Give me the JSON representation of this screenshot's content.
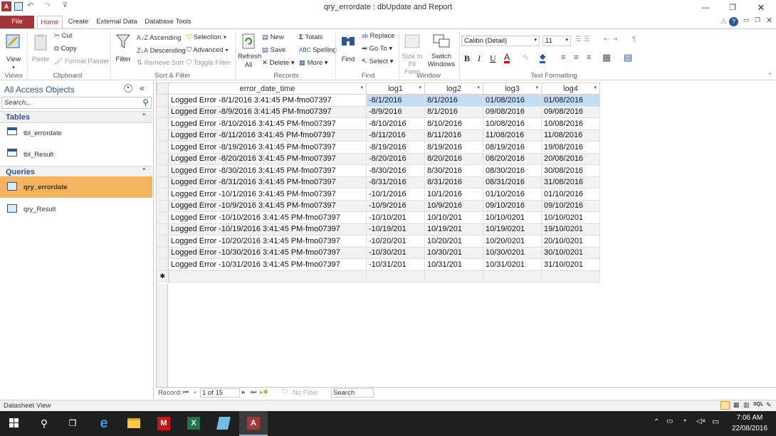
{
  "window": {
    "title": "qry_errordate : dbUpdate and Report"
  },
  "ribbon_tabs": [
    "File",
    "Home",
    "Create",
    "External Data",
    "Database Tools"
  ],
  "ribbon": {
    "views": {
      "view": "View",
      "group": "Views"
    },
    "clipboard": {
      "paste": "Paste",
      "cut": "Cut",
      "copy": "Copy",
      "format_painter": "Format Painter",
      "group": "Clipboard"
    },
    "sort_filter": {
      "filter": "Filter",
      "ascending": "Ascending",
      "descending": "Descending",
      "remove_sort": "Remove Sort",
      "selection": "Selection",
      "advanced": "Advanced",
      "toggle_filter": "Toggle Filter",
      "group": "Sort & Filter"
    },
    "records": {
      "refresh_all": "Refresh All",
      "new": "New",
      "save": "Save",
      "delete": "Delete",
      "totals": "Totals",
      "spelling": "Spelling",
      "more": "More",
      "group": "Records"
    },
    "find": {
      "find": "Find",
      "replace": "Replace",
      "go_to": "Go To",
      "select": "Select",
      "group": "Find"
    },
    "window": {
      "size_to_fit": "Size to Fit Form",
      "switch_windows": "Switch Windows",
      "group": "Window"
    },
    "text_formatting": {
      "font": "Calibri (Detail)",
      "size": "11",
      "group": "Text Formatting",
      "bold": "B",
      "italic": "I",
      "underline": "U",
      "font_color": "A"
    }
  },
  "nav": {
    "title": "All Access Objects",
    "search_placeholder": "Search...",
    "tables_header": "Tables",
    "tables": [
      "tbl_errordate",
      "tbl_Result"
    ],
    "queries_header": "Queries",
    "queries": [
      "qry_errordate",
      "qry_Result"
    ]
  },
  "datasheet": {
    "columns": [
      "error_date_time",
      "log1",
      "log2",
      "log3",
      "log4"
    ],
    "rows": [
      [
        "Logged Error -8/1/2016 3:41:45 PM-fmo07397",
        "-8/1/2016",
        "8/1/2016",
        "01/08/2016",
        "01/08/2016"
      ],
      [
        "Logged Error -8/9/2016 3:41:45 PM-fmo07397",
        "-8/9/2016",
        "8/1/2016",
        "09/08/2016",
        "09/08/2016"
      ],
      [
        "Logged Error -8/10/2016 3:41:45 PM-fmo07397",
        "-8/10/2016",
        "8/10/2016",
        "10/08/2016",
        "10/08/2016"
      ],
      [
        "Logged Error -8/11/2016 3:41:45 PM-fmo07397",
        "-8/11/2016",
        "8/11/2016",
        "11/08/2016",
        "11/08/2016"
      ],
      [
        "Logged Error -8/19/2016 3:41:45 PM-fmo07397",
        "-8/19/2016",
        "8/19/2016",
        "08/19/2016",
        "19/08/2016"
      ],
      [
        "Logged Error -8/20/2016 3:41:45 PM-fmo07397",
        "-8/20/2016",
        "8/20/2016",
        "08/20/2016",
        "20/08/2016"
      ],
      [
        "Logged Error -8/30/2016 3:41:45 PM-fmo07397",
        "-8/30/2016",
        "8/30/2016",
        "08/30/2016",
        "30/08/2016"
      ],
      [
        "Logged Error -8/31/2016 3:41:45 PM-fmo07397",
        "-8/31/2016",
        "8/31/2016",
        "08/31/2016",
        "31/08/2016"
      ],
      [
        "Logged Error -10/1/2016 3:41:45 PM-fmo07397",
        "-10/1/2016",
        "10/1/2016",
        "01/10/2016",
        "01/10/2016"
      ],
      [
        "Logged Error -10/9/2016 3:41:45 PM-fmo07397",
        "-10/9/2016",
        "10/9/2016",
        "09/10/2016",
        "09/10/2016"
      ],
      [
        "Logged Error -10/10/2016 3:41:45 PM-fmo07397",
        "-10/10/201",
        "10/10/201",
        "10/10/0201",
        "10/10/0201"
      ],
      [
        "Logged Error -10/19/2016 3:41:45 PM-fmo07397",
        "-10/19/201",
        "10/19/201",
        "10/19/0201",
        "19/10/0201"
      ],
      [
        "Logged Error -10/20/2016 3:41:45 PM-fmo07397",
        "-10/20/201",
        "10/20/201",
        "10/20/0201",
        "20/10/0201"
      ],
      [
        "Logged Error -10/30/2016 3:41:45 PM-fmo07397",
        "-10/30/201",
        "10/30/201",
        "10/30/0201",
        "30/10/0201"
      ],
      [
        "Logged Error -10/31/2016 3:41:45 PM-fmo07397",
        "-10/31/201",
        "10/31/201",
        "10/31/0201",
        "31/10/0201"
      ]
    ],
    "new_row_marker": "✱"
  },
  "record_nav": {
    "label": "Record:",
    "position": "1 of 15",
    "filter": "No Filter",
    "search": "Search"
  },
  "status": {
    "left": "Datasheet View"
  },
  "clock": {
    "time": "7:06 AM",
    "date": "22/08/2016"
  },
  "colors": {
    "access_red": "#a4373a",
    "selection": "#c5dcf5",
    "nav_selected": "#f4b45f",
    "taskbar": "#1f1f1f"
  }
}
